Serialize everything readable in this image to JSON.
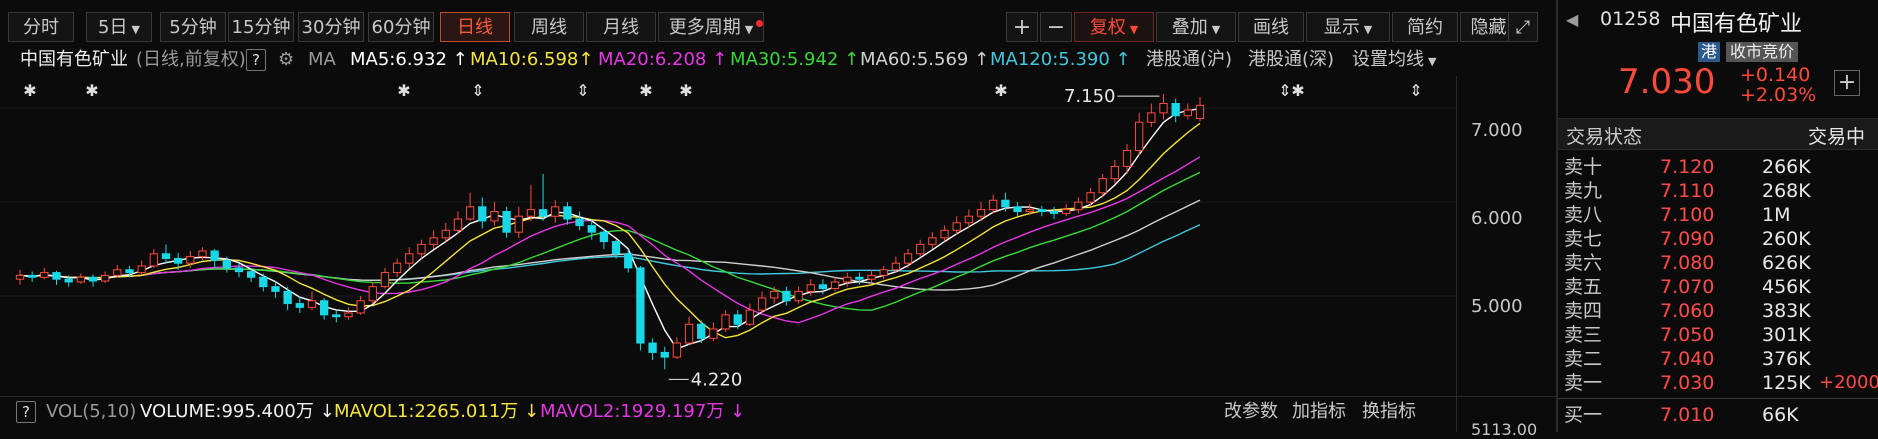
{
  "toolbar": {
    "periods": [
      {
        "label": "分时"
      },
      {
        "label": "5日",
        "caret": true
      },
      {
        "label": "5分钟"
      },
      {
        "label": "15分钟"
      },
      {
        "label": "30分钟"
      },
      {
        "label": "60分钟"
      },
      {
        "label": "日线",
        "active": true
      },
      {
        "label": "周线"
      },
      {
        "label": "月线"
      },
      {
        "label": "更多周期",
        "caret": true
      }
    ],
    "plus": "+",
    "minus": "−",
    "fuquan": "复权",
    "diejia": "叠加",
    "huaxian": "画线",
    "xianshi": "显示",
    "jianyue": "简约",
    "yincang": "隐藏"
  },
  "ma_row": {
    "stock_name": "中国有色矿业",
    "period_note": "(日线,前复权)",
    "help": "?",
    "ma_label": "MA",
    "ma5": "MA5:6.932",
    "ma10": "MA10:6.598",
    "ma20": "MA20:6.208",
    "ma30": "MA30:5.942",
    "ma60": "MA60:5.569",
    "ma120": "MA120:5.390",
    "gtong_hu": "港股通(沪)",
    "gtong_shen": "港股通(深)",
    "set_ma": "设置均线"
  },
  "colors": {
    "ma5": "#ffffff",
    "ma10": "#f6e53a",
    "ma20": "#e637e6",
    "ma30": "#38d838",
    "ma60": "#d0d0d0",
    "ma120": "#3fc8dc",
    "up": "#ff4a3a",
    "down": "#18d8e8",
    "accent": "#ff4a3a"
  },
  "annotations": {
    "high": "7.150",
    "low": "4.220"
  },
  "price_axis": {
    "ticks": [
      "7.000",
      "6.000",
      "5.000"
    ],
    "bottom_cut": "5113.00"
  },
  "vol_row": {
    "help": "?",
    "vol_label": "VOL(5,10)",
    "volume": "VOLUME:995.400万",
    "mavol1": "MAVOL1:2265.011万",
    "mavol2": "MAVOL2:1929.197万",
    "change_param": "改参数",
    "add_indicator": "加指标",
    "switch_indicator": "换指标"
  },
  "right_panel": {
    "code": "01258",
    "name": "中国有色矿业",
    "hk_badge": "港",
    "auction_badge": "收市竞价",
    "price": "7.030",
    "change": "+0.140",
    "change_pct": "+2.03%",
    "plus_btn": "+",
    "status_label": "交易状态",
    "status_value": "交易中",
    "asks": [
      {
        "label": "卖十",
        "price": "7.120",
        "vol": "266K"
      },
      {
        "label": "卖九",
        "price": "7.110",
        "vol": "268K"
      },
      {
        "label": "卖八",
        "price": "7.100",
        "vol": "1M"
      },
      {
        "label": "卖七",
        "price": "7.090",
        "vol": "260K"
      },
      {
        "label": "卖六",
        "price": "7.080",
        "vol": "626K"
      },
      {
        "label": "卖五",
        "price": "7.070",
        "vol": "456K"
      },
      {
        "label": "卖四",
        "price": "7.060",
        "vol": "383K"
      },
      {
        "label": "卖三",
        "price": "7.050",
        "vol": "301K"
      },
      {
        "label": "卖二",
        "price": "7.040",
        "vol": "376K"
      },
      {
        "label": "卖一",
        "price": "7.030",
        "vol": "125K",
        "chg": "+2000"
      }
    ],
    "bid1": {
      "label": "买一",
      "price": "7.010",
      "vol": "66K"
    }
  },
  "chart_data": {
    "type": "candlestick",
    "ylim": [
      4.0,
      7.3
    ],
    "candles": [
      [
        5.18,
        5.22,
        5.28,
        5.12
      ],
      [
        5.22,
        5.2,
        5.26,
        5.15
      ],
      [
        5.2,
        5.25,
        5.3,
        5.18
      ],
      [
        5.25,
        5.18,
        5.27,
        5.12
      ],
      [
        5.18,
        5.15,
        5.22,
        5.1
      ],
      [
        5.15,
        5.2,
        5.24,
        5.13
      ],
      [
        5.2,
        5.16,
        5.23,
        5.1
      ],
      [
        5.16,
        5.22,
        5.26,
        5.14
      ],
      [
        5.22,
        5.28,
        5.33,
        5.2
      ],
      [
        5.28,
        5.25,
        5.32,
        5.2
      ],
      [
        5.25,
        5.32,
        5.38,
        5.23
      ],
      [
        5.32,
        5.45,
        5.5,
        5.3
      ],
      [
        5.45,
        5.4,
        5.55,
        5.35
      ],
      [
        5.4,
        5.35,
        5.46,
        5.28
      ],
      [
        5.35,
        5.42,
        5.48,
        5.3
      ],
      [
        5.42,
        5.48,
        5.52,
        5.38
      ],
      [
        5.48,
        5.38,
        5.5,
        5.3
      ],
      [
        5.38,
        5.3,
        5.42,
        5.25
      ],
      [
        5.3,
        5.26,
        5.35,
        5.2
      ],
      [
        5.26,
        5.2,
        5.3,
        5.15
      ],
      [
        5.2,
        5.1,
        5.24,
        5.05
      ],
      [
        5.1,
        5.05,
        5.16,
        4.98
      ],
      [
        5.05,
        4.92,
        5.1,
        4.85
      ],
      [
        4.92,
        4.88,
        5.0,
        4.82
      ],
      [
        4.88,
        4.95,
        5.05,
        4.85
      ],
      [
        4.95,
        4.8,
        4.98,
        4.75
      ],
      [
        4.8,
        4.78,
        4.85,
        4.72
      ],
      [
        4.78,
        4.82,
        4.88,
        4.75
      ],
      [
        4.82,
        4.95,
        5.0,
        4.8
      ],
      [
        4.95,
        5.1,
        5.15,
        4.92
      ],
      [
        5.1,
        5.25,
        5.3,
        5.08
      ],
      [
        5.25,
        5.35,
        5.4,
        5.2
      ],
      [
        5.35,
        5.45,
        5.52,
        5.3
      ],
      [
        5.45,
        5.55,
        5.6,
        5.4
      ],
      [
        5.55,
        5.62,
        5.7,
        5.5
      ],
      [
        5.62,
        5.7,
        5.78,
        5.58
      ],
      [
        5.7,
        5.82,
        5.9,
        5.66
      ],
      [
        5.82,
        5.95,
        6.1,
        5.8
      ],
      [
        5.95,
        5.8,
        6.05,
        5.72
      ],
      [
        5.8,
        5.9,
        6.0,
        5.75
      ],
      [
        5.9,
        5.68,
        5.95,
        5.62
      ],
      [
        5.68,
        5.85,
        5.95,
        5.62
      ],
      [
        5.85,
        5.92,
        6.18,
        5.8
      ],
      [
        5.92,
        5.85,
        6.3,
        5.8
      ],
      [
        5.85,
        5.95,
        6.02,
        5.78
      ],
      [
        5.95,
        5.82,
        6.0,
        5.76
      ],
      [
        5.82,
        5.75,
        5.9,
        5.7
      ],
      [
        5.75,
        5.68,
        5.82,
        5.6
      ],
      [
        5.68,
        5.58,
        5.72,
        5.5
      ],
      [
        5.58,
        5.45,
        5.6,
        5.4
      ],
      [
        5.45,
        5.3,
        5.5,
        5.25
      ],
      [
        5.3,
        4.5,
        5.32,
        4.42
      ],
      [
        4.5,
        4.4,
        4.55,
        4.32
      ],
      [
        4.4,
        4.35,
        4.46,
        4.22
      ],
      [
        4.35,
        4.5,
        4.56,
        4.33
      ],
      [
        4.5,
        4.7,
        4.78,
        4.48
      ],
      [
        4.7,
        4.55,
        4.74,
        4.5
      ],
      [
        4.55,
        4.65,
        4.72,
        4.52
      ],
      [
        4.65,
        4.8,
        4.85,
        4.62
      ],
      [
        4.8,
        4.7,
        4.85,
        4.65
      ],
      [
        4.7,
        4.85,
        4.92,
        4.68
      ],
      [
        4.85,
        4.98,
        5.05,
        4.82
      ],
      [
        4.98,
        5.05,
        5.1,
        4.92
      ],
      [
        5.05,
        4.95,
        5.1,
        4.9
      ],
      [
        4.95,
        5.05,
        5.1,
        4.92
      ],
      [
        5.05,
        5.12,
        5.18,
        5.0
      ],
      [
        5.12,
        5.08,
        5.18,
        5.02
      ],
      [
        5.08,
        5.15,
        5.2,
        5.05
      ],
      [
        5.15,
        5.2,
        5.25,
        5.1
      ],
      [
        5.2,
        5.18,
        5.25,
        5.12
      ],
      [
        5.18,
        5.22,
        5.28,
        5.15
      ],
      [
        5.22,
        5.28,
        5.32,
        5.18
      ],
      [
        5.28,
        5.35,
        5.42,
        5.25
      ],
      [
        5.35,
        5.45,
        5.5,
        5.3
      ],
      [
        5.45,
        5.55,
        5.6,
        5.42
      ],
      [
        5.55,
        5.62,
        5.68,
        5.5
      ],
      [
        5.62,
        5.7,
        5.75,
        5.58
      ],
      [
        5.7,
        5.78,
        5.85,
        5.65
      ],
      [
        5.78,
        5.85,
        5.92,
        5.72
      ],
      [
        5.85,
        5.92,
        6.0,
        5.8
      ],
      [
        5.92,
        6.02,
        6.08,
        5.88
      ],
      [
        6.02,
        5.95,
        6.1,
        5.9
      ],
      [
        5.95,
        5.9,
        6.0,
        5.85
      ],
      [
        5.9,
        5.92,
        5.98,
        5.86
      ],
      [
        5.92,
        5.9,
        5.96,
        5.85
      ],
      [
        5.9,
        5.88,
        5.95,
        5.82
      ],
      [
        5.88,
        5.92,
        5.98,
        5.85
      ],
      [
        5.92,
        6.0,
        6.05,
        5.88
      ],
      [
        6.0,
        6.1,
        6.15,
        5.95
      ],
      [
        6.1,
        6.25,
        6.3,
        6.05
      ],
      [
        6.25,
        6.38,
        6.45,
        6.2
      ],
      [
        6.38,
        6.55,
        6.62,
        6.3
      ],
      [
        6.55,
        6.85,
        6.95,
        6.5
      ],
      [
        6.85,
        6.95,
        7.05,
        6.8
      ],
      [
        6.95,
        7.05,
        7.15,
        6.88
      ],
      [
        7.05,
        6.92,
        7.1,
        6.85
      ],
      [
        6.92,
        6.98,
        7.05,
        6.88
      ],
      [
        6.89,
        7.03,
        7.12,
        6.86
      ]
    ]
  }
}
